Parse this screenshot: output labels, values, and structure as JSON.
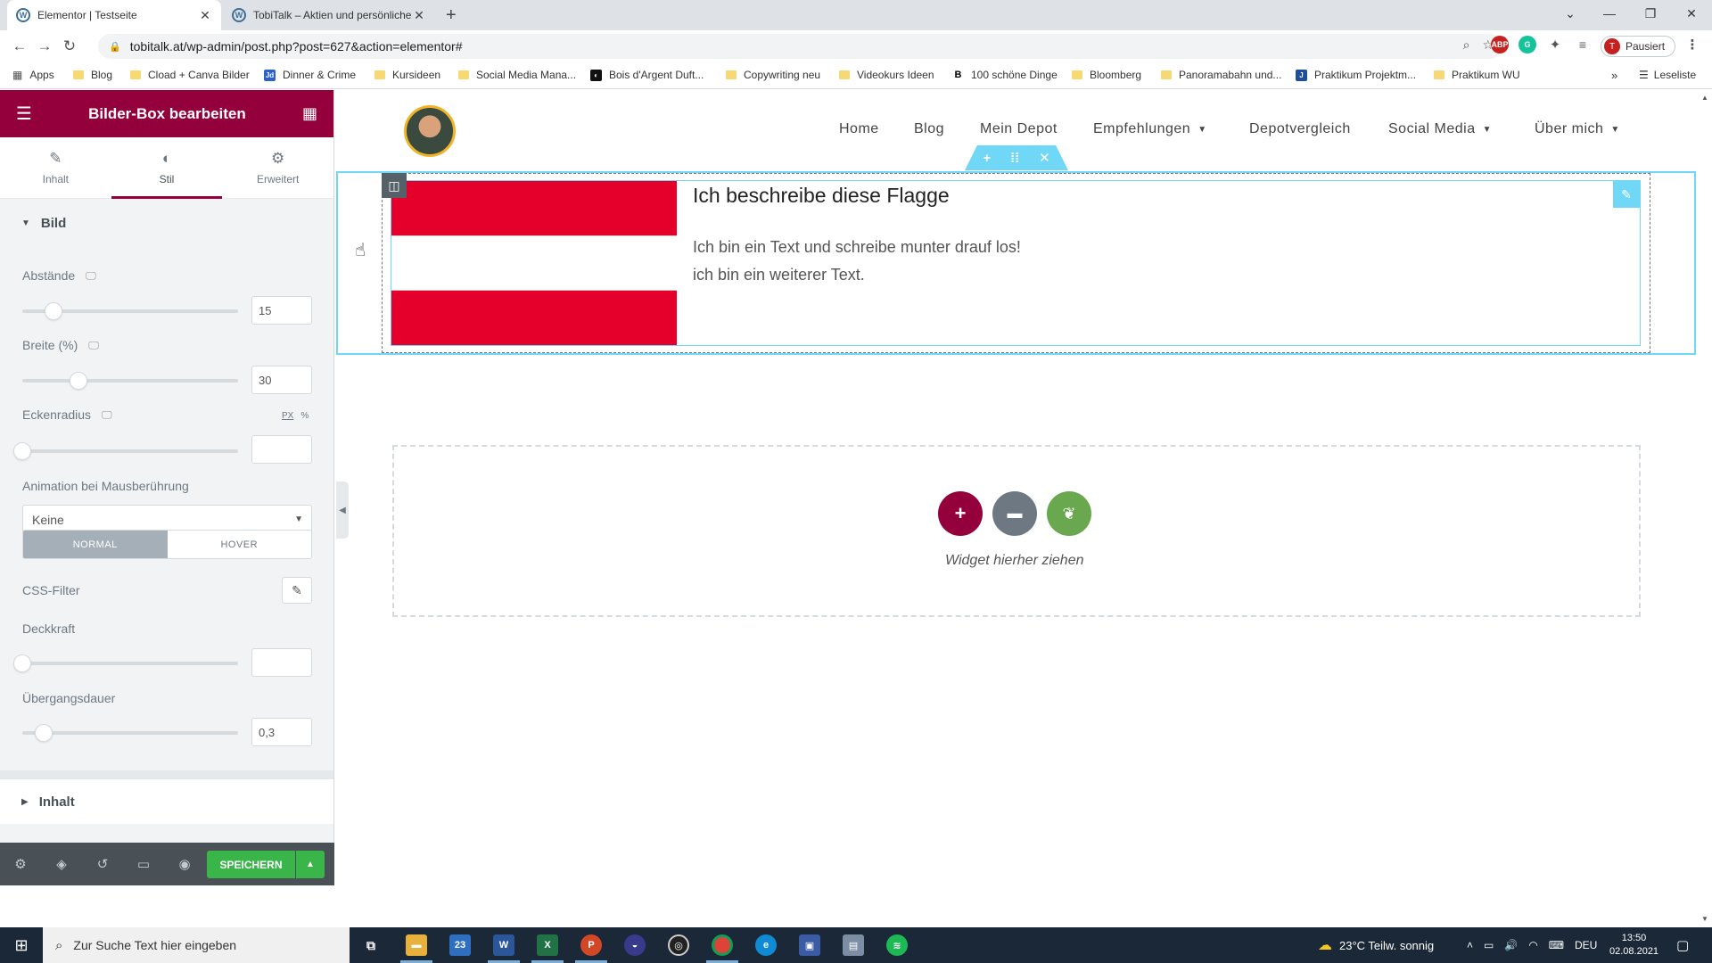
{
  "browser": {
    "tabs": [
      {
        "title": "Elementor | Testseite",
        "active": true
      },
      {
        "title": "TobiTalk – Aktien und persönliche",
        "active": false
      }
    ],
    "url": "tobitalk.at/wp-admin/post.php?post=627&action=elementor#",
    "profile_label": "Pausiert",
    "profile_initial": "T",
    "bookmarks": [
      "Apps",
      "Blog",
      "Cload + Canva Bilder",
      "Dinner & Crime",
      "Kursideen",
      "Social Media Mana...",
      "Bois d'Argent Duft...",
      "Copywriting neu",
      "Videokurs Ideen",
      "100 schöne Dinge",
      "Bloomberg",
      "Panoramabahn und...",
      "Praktikum Projektm...",
      "Praktikum WU"
    ],
    "reading_list": "Leseliste"
  },
  "panel": {
    "title": "Bilder-Box bearbeiten",
    "tabs": [
      {
        "label": "Inhalt",
        "icon": "pencil-icon"
      },
      {
        "label": "Stil",
        "icon": "contrast-icon"
      },
      {
        "label": "Erweitert",
        "icon": "gear-icon"
      }
    ],
    "section_bild": "Bild",
    "abstaende_label": "Abstände",
    "abstaende_value": "15",
    "breite_label": "Breite (%)",
    "breite_value": "30",
    "eckenradius_label": "Eckenradius",
    "unit_px": "PX",
    "unit_pct": "%",
    "animation_label": "Animation bei Mausberührung",
    "animation_value": "Keine",
    "state_normal": "NORMAL",
    "state_hover": "HOVER",
    "cssfilter_label": "CSS-Filter",
    "deckkraft_label": "Deckkraft",
    "uebergang_label": "Übergangsdauer",
    "uebergang_value": "0,3",
    "section_inhalt": "Inhalt",
    "save_label": "SPEICHERN"
  },
  "site": {
    "nav": [
      {
        "label": "Home",
        "has_dropdown": false
      },
      {
        "label": "Blog",
        "has_dropdown": false
      },
      {
        "label": "Mein Depot",
        "has_dropdown": false
      },
      {
        "label": "Empfehlungen",
        "has_dropdown": true
      },
      {
        "label": "Depotvergleich",
        "has_dropdown": false
      },
      {
        "label": "Social Media",
        "has_dropdown": true
      },
      {
        "label": "Über mich",
        "has_dropdown": true
      }
    ],
    "imagebox_title": "Ich beschreibe diese Flagge",
    "imagebox_line1": "Ich bin ein Text und schreibe munter drauf los!",
    "imagebox_line2": "ich bin ein weiterer Text.",
    "drop_text": "Widget hierher ziehen"
  },
  "taskbar": {
    "search_placeholder": "Zur Suche Text hier eingeben",
    "weather": "23°C  Teilw. sonnig",
    "language": "DEU",
    "time": "13:50",
    "date": "02.08.2021",
    "mail_badge": "23"
  },
  "colors": {
    "elementor_primary": "#93003c",
    "accent_cyan": "#71d7f7",
    "save_green": "#39b54a",
    "flag_red": "#e4002b"
  }
}
